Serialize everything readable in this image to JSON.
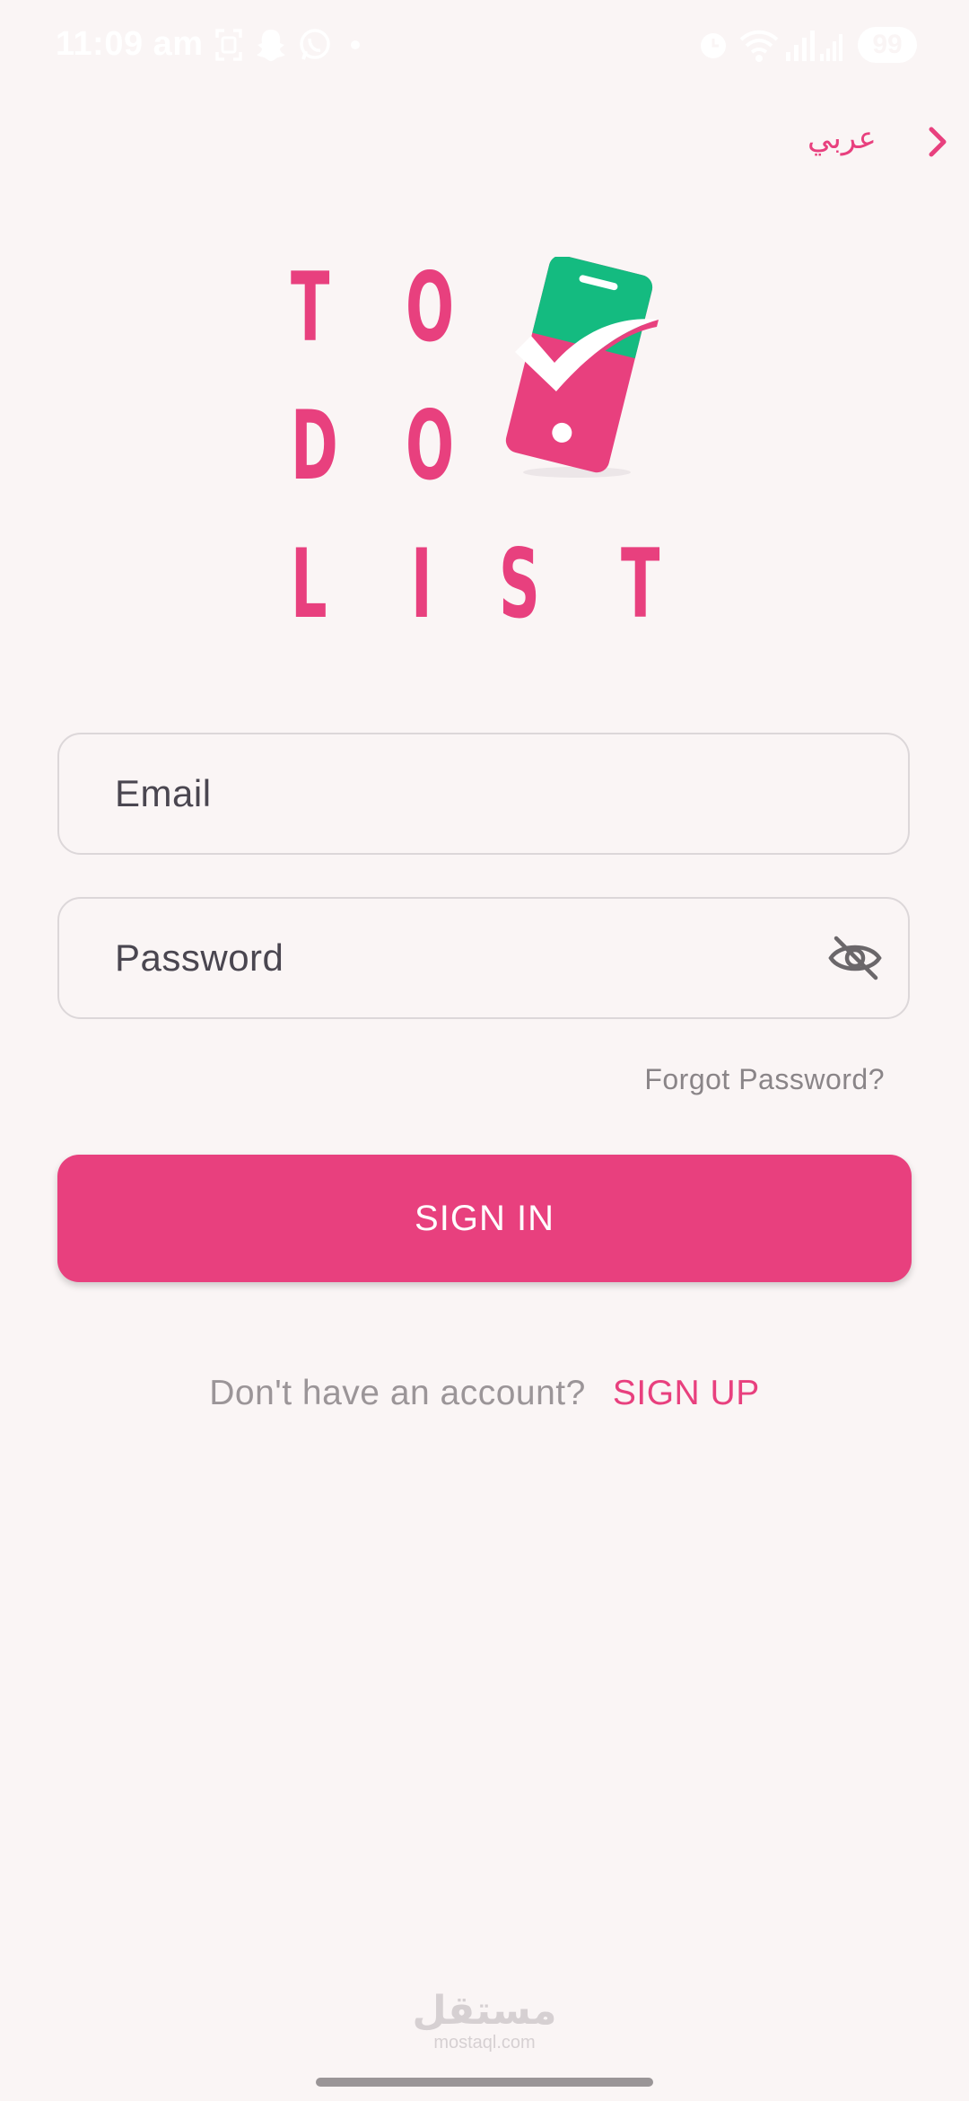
{
  "status_bar": {
    "time": "11:09 am",
    "battery": "99"
  },
  "language": {
    "label": "عربي"
  },
  "logo": {
    "rows": [
      [
        "T",
        "O"
      ],
      [
        "D",
        "O"
      ],
      [
        "L",
        "I",
        "S",
        "T"
      ]
    ],
    "colors": {
      "primary": "#e8407e",
      "secondary": "#14bb80"
    }
  },
  "form": {
    "email_placeholder": "Email",
    "password_placeholder": "Password",
    "forgot_label": "Forgot Password?",
    "signin_label": "SIGN IN"
  },
  "signup": {
    "prompt": "Don't have an account?",
    "link": "SIGN UP"
  },
  "watermark": {
    "arabic": "مستقل",
    "latin": "mostaql.com"
  },
  "colors": {
    "accent": "#e8407e",
    "background": "#faf5f5",
    "border": "#dcd7d9"
  }
}
